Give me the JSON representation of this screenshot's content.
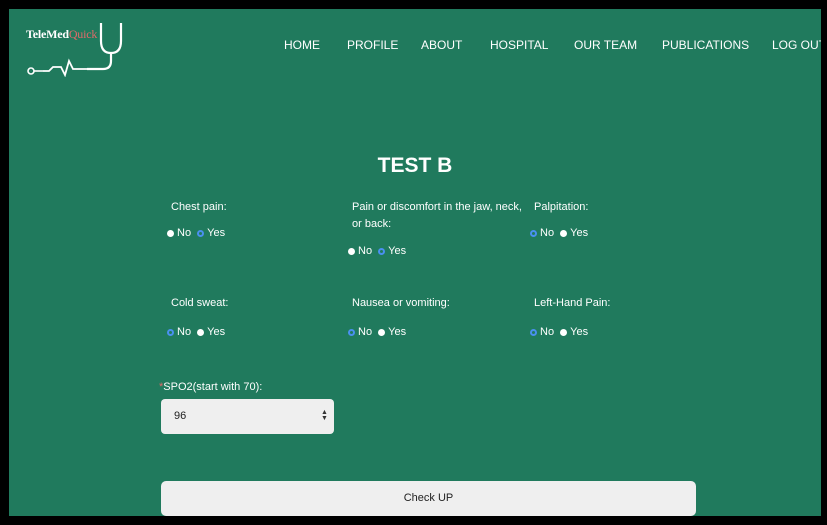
{
  "brand": {
    "logo_text_part1": "TeleMed",
    "logo_text_part2": "Quick",
    "logo_icon": "stethoscope-heartbeat-icon"
  },
  "nav": {
    "home": "HOME",
    "profile": "PROFILE",
    "about": "ABOUT",
    "hospital": "HOSPITAL",
    "our_team": "OUR TEAM",
    "publications": "PUBLICATIONS",
    "log_out": "LOG OUT"
  },
  "form": {
    "title": "TEST B",
    "option_no": "No",
    "option_yes": "Yes",
    "questions": {
      "chest_pain": {
        "label": "Chest pain:",
        "selected": "Yes"
      },
      "jaw_pain": {
        "label": "Pain or discomfort in the jaw, neck, or back:",
        "selected": "Yes"
      },
      "palpitation": {
        "label": "Palpitation:",
        "selected": "No"
      },
      "cold_sweat": {
        "label": "Cold sweat:",
        "selected": "No"
      },
      "nausea": {
        "label": "Nausea or vomiting:",
        "selected": "No"
      },
      "left_hand_pain": {
        "label": "Left-Hand Pain:",
        "selected": "No"
      }
    },
    "spo2": {
      "required_mark": "*",
      "label": "SPO2(start with 70):",
      "value": "96"
    },
    "submit_label": "Check UP"
  },
  "colors": {
    "background": "#207a5d",
    "selected_radio": "#4a90f0",
    "required": "#e06a6a"
  }
}
